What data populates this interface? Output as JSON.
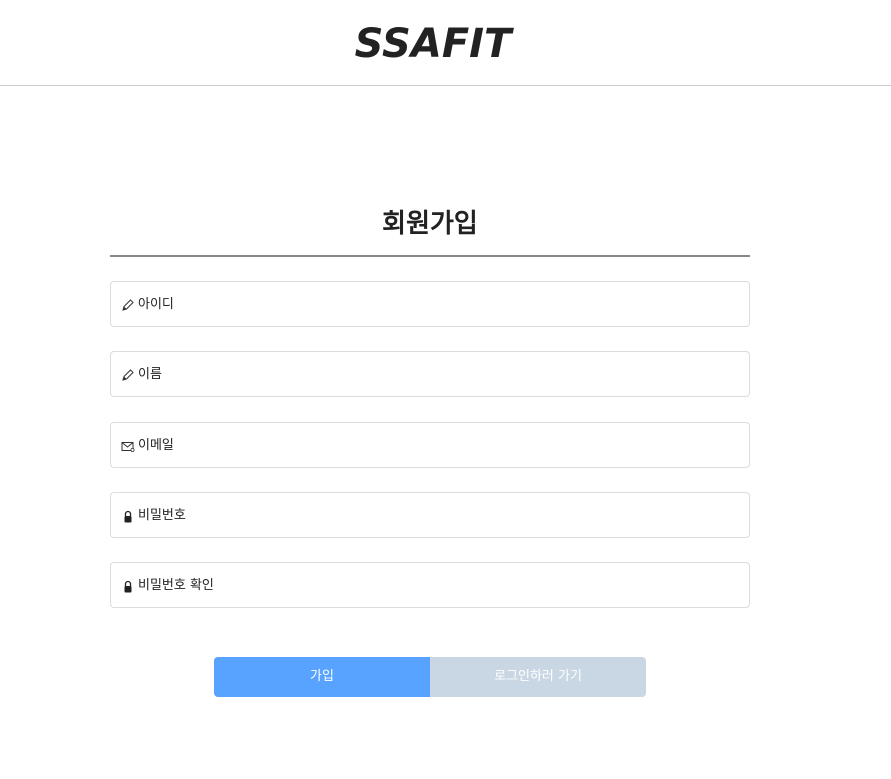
{
  "header": {
    "logo": "SSAFIT"
  },
  "form": {
    "title": "회원가입",
    "fields": [
      {
        "icon": "pencil-icon",
        "placeholder": "아이디",
        "value": ""
      },
      {
        "icon": "pencil-icon",
        "placeholder": "이름",
        "value": ""
      },
      {
        "icon": "envelope-icon",
        "placeholder": "이메일",
        "value": ""
      },
      {
        "icon": "lock-icon",
        "placeholder": "비밀번호",
        "value": ""
      },
      {
        "icon": "lock-icon",
        "placeholder": "비밀번호 확인",
        "value": ""
      }
    ],
    "buttons": {
      "join_label": "가입",
      "login_label": "로그인하러 가기"
    }
  },
  "colors": {
    "primary_button": "#57a3ff",
    "secondary_button": "#c9d6e3",
    "divider": "#888888"
  }
}
